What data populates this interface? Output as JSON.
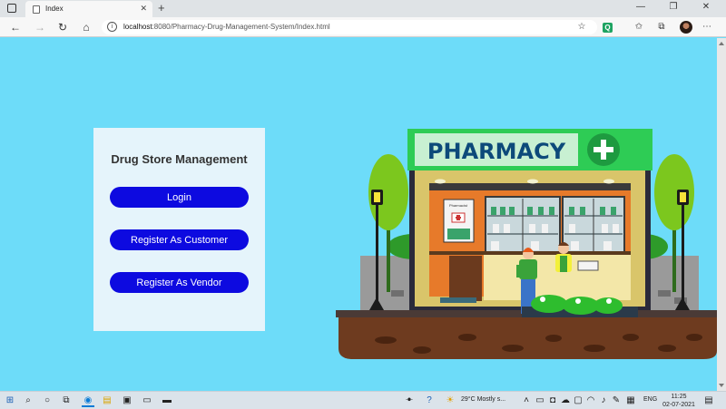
{
  "browser": {
    "tab_title": "Index",
    "url_host": "localhost",
    "url_rest": ":8080/Pharmacy-Drug-Management-System/Index.html",
    "ext_letter": "Q"
  },
  "card": {
    "title": "Drug Store Management",
    "login_label": "Login",
    "register_customer_label": "Register As Customer",
    "register_vendor_label": "Register As Vendor",
    "button_color": "#0d0ae0"
  },
  "illustration": {
    "sign_text": "PHARMACY",
    "poster_text": "Pharmacist",
    "sign_color": "#2ecc55",
    "sign_text_color": "#0d4a7a"
  },
  "taskbar": {
    "weather": "29°C  Mostly s...",
    "language": "ENG",
    "time": "11:25",
    "date": "02-07-2021"
  }
}
